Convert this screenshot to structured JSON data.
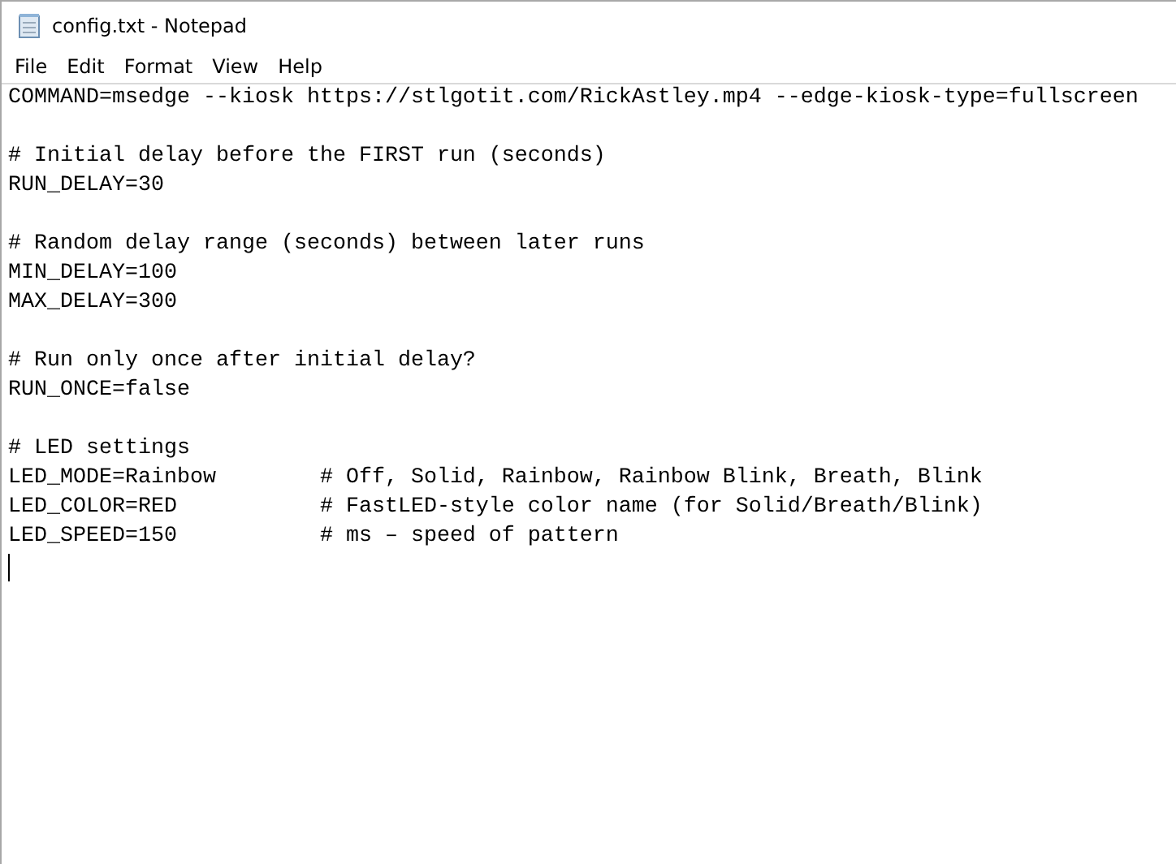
{
  "window": {
    "title": "config.txt - Notepad"
  },
  "menu": [
    "File",
    "Edit",
    "Format",
    "View",
    "Help"
  ],
  "blocks": [
    [
      "COMMAND=msedge --kiosk https://stlgotit.com/RickAstley.mp4 --edge-kiosk-type=fullscreen"
    ],
    [
      "# Initial delay before the FIRST run (seconds)",
      "RUN_DELAY=30"
    ],
    [
      "# Random delay range (seconds) between later runs",
      "MIN_DELAY=100",
      "MAX_DELAY=300"
    ],
    [
      "# Run only once after initial delay?",
      "RUN_ONCE=false"
    ],
    [
      "# LED settings",
      "LED_MODE=Rainbow        # Off, Solid, Rainbow, Rainbow Blink, Breath, Blink",
      "LED_COLOR=RED           # FastLED-style color name (for Solid/Breath/Blink)",
      "LED_SPEED=150           # ms – speed of pattern"
    ]
  ]
}
